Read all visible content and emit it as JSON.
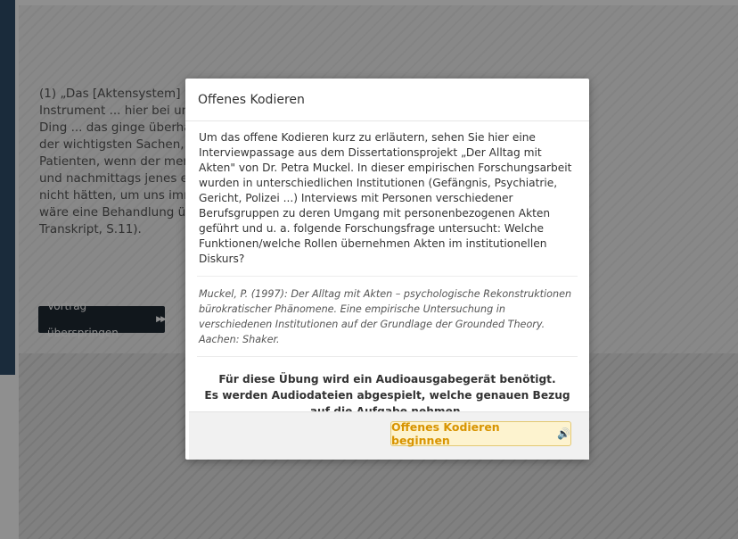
{
  "background": {
    "transcript_text": "(1) „Das [Aktensystem] ist i\nInstrument ... hier bei uns a\nDing ... das ginge überhaup\nder wichtigsten Sachen, we\nPatienten, wenn der merkt\nund nachmittags jenes erzä\nnicht hätten, um uns immer\nwäre eine Behandlung über\nTranskript, S.11).",
    "skip_label": "Vortrag überspringen",
    "skip_icon": "fast-forward-icon"
  },
  "modal": {
    "title": "Offenes Kodieren",
    "intro": "Um das offene Kodieren kurz zu erläutern, sehen Sie hier eine Interviewpassage aus dem Dissertationsprojekt „Der Alltag mit Akten\" von Dr. Petra Muckel. In dieser empirischen Forschungsarbeit wurden in unterschiedlichen Institutionen (Gefängnis, Psychiatrie, Gericht, Polizei ...) Interviews mit Personen verschiedener Berufsgruppen zu deren Umgang mit personenbezogenen Akten geführt und u. a. folgende Forschungsfrage untersucht: Welche Funktionen/welche Rollen übernehmen Akten im institutionellen Diskurs?",
    "citation": "Muckel, P. (1997): Der Alltag mit Akten – psychologische Rekonstruktionen bürokratischer Phänomene. Eine empirische Untersuchung in verschiedenen Institutionen auf der Grundlage der Grounded Theory. Aachen: Shaker.",
    "notice_line1": "Für diese Übung wird ein Audioausgabegerät benötigt.",
    "notice_line2": "Es werden Audiodateien abgespielt, welche genauen Bezug auf die Aufgabe nehmen.",
    "start_label": "Offenes Kodieren beginnen",
    "start_icon": "speaker-icon"
  },
  "colors": {
    "start_button_bg": "#fdf3cf",
    "start_button_text": "#d89400",
    "skip_button_bg": "#1f2933",
    "left_strip": "#2f4d6a"
  }
}
